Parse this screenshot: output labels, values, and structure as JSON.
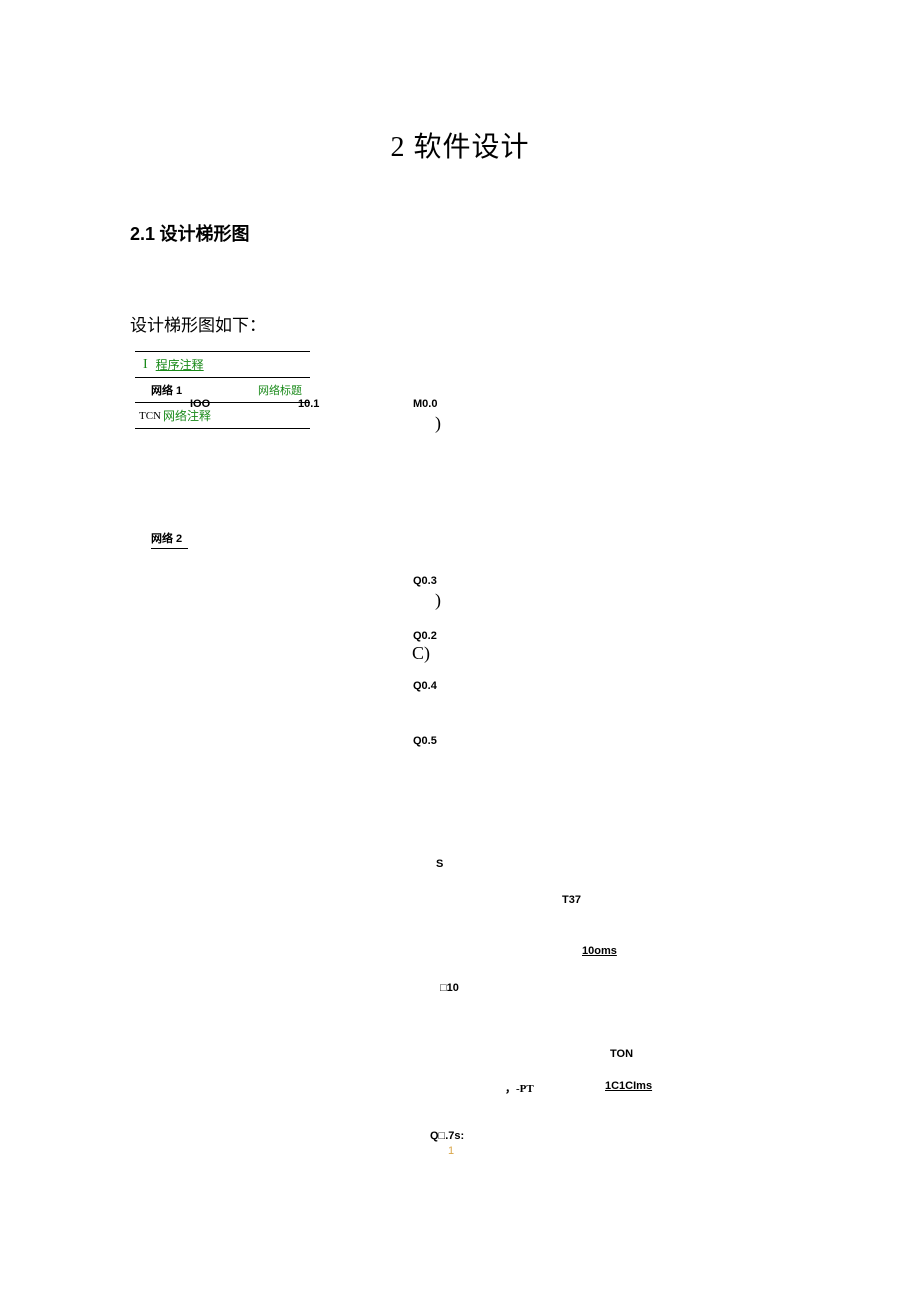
{
  "title": {
    "num": "2",
    "text": "软件设计"
  },
  "section": {
    "num": "2.1",
    "text": "设计梯形图"
  },
  "intro": "设计梯形图如下：",
  "diagram": {
    "row1": {
      "glyph": "I",
      "label": "程序注释"
    },
    "row2": {
      "net": "网络 1",
      "title": "网络标题"
    },
    "row3": {
      "prefix": "TCN",
      "label": "网络注释"
    }
  },
  "labels": {
    "ioo": "IOO",
    "io1": "10.1",
    "m00": "M0.0",
    "net2": "网络 2",
    "q03": "Q0.3",
    "q02": "Q0.2",
    "q04": "Q0.4",
    "q05": "Q0.5",
    "C": "C)",
    "paren1": ")",
    "paren2": ")",
    "S": "S",
    "T37": "T37",
    "hundoms": "10oms",
    "box10": "□10",
    "TON": "TON",
    "pt": "，-PT",
    "c1c1ms": "1C1CIms",
    "q07s": "Q□.7s:",
    "one": "1"
  }
}
